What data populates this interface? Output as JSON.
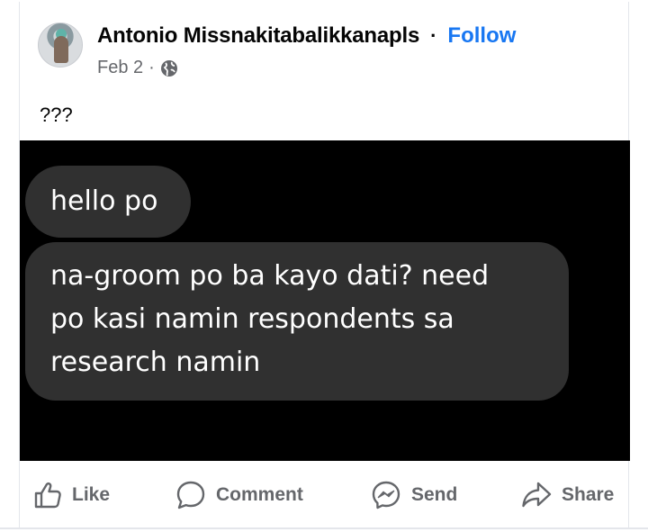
{
  "post": {
    "author": "Antonio Missnakitabalikkanapls",
    "separator": "·",
    "follow_label": "Follow",
    "date": "Feb 2",
    "meta_separator": "·",
    "privacy_icon": "globe-icon",
    "caption": "???"
  },
  "media": {
    "messages": [
      {
        "lines": [
          "hello po"
        ]
      },
      {
        "lines": [
          "na-groom po ba kayo dati? need",
          "po kasi namin respondents sa",
          "research namin"
        ]
      }
    ]
  },
  "actions": [
    {
      "label": "Like",
      "icon": "thumbs-up-icon"
    },
    {
      "label": "Comment",
      "icon": "comment-icon"
    },
    {
      "label": "Send",
      "icon": "messenger-icon"
    },
    {
      "label": "Share",
      "icon": "share-icon"
    }
  ],
  "colors": {
    "brand": "#1877f2",
    "secondary_text": "#65676b",
    "bubble": "#303030",
    "media_background": "#000000"
  }
}
